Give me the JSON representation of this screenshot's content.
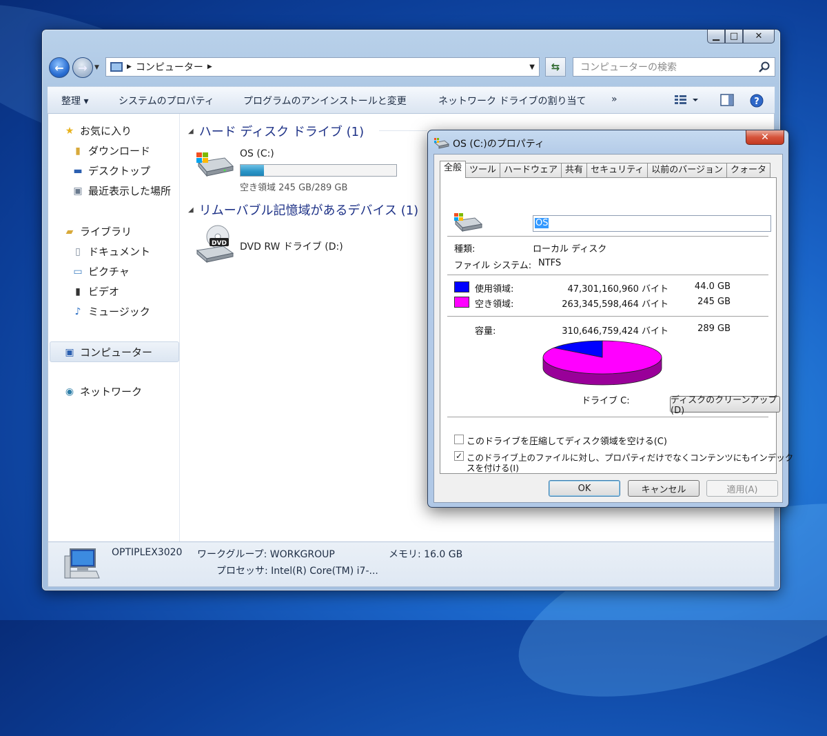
{
  "explorer": {
    "caption": {
      "minimize": "▁",
      "maximize": "□",
      "close": "✕"
    },
    "address": {
      "location": "コンピューター"
    },
    "search": {
      "placeholder": "コンピューターの検索"
    },
    "toolbar": {
      "organize": "整理 ▾",
      "system_properties": "システムのプロパティ",
      "uninstall": "プログラムのアンインストールと変更",
      "map_drive": "ネットワーク ドライブの割り当て",
      "more": "»"
    },
    "nav_pane": {
      "favorites": "お気に入り",
      "downloads": "ダウンロード",
      "desktop": "デスクトップ",
      "recent": "最近表示した場所",
      "libraries": "ライブラリ",
      "documents": "ドキュメント",
      "pictures": "ピクチャ",
      "videos": "ビデオ",
      "music": "ミュージック",
      "computer": "コンピューター",
      "network": "ネットワーク"
    },
    "groups": {
      "hdd_header": "ハード ディスク ドライブ (1)",
      "removable_header": "リムーバブル記憶域があるデバイス (1)"
    },
    "drives": {
      "c": {
        "name": "OS (C:)",
        "free_text": "空き領域 245 GB/289 GB",
        "used_fraction": 0.152
      },
      "d": {
        "name": "DVD RW ドライブ (D:)",
        "badge": "DVD"
      }
    },
    "status": {
      "computer_name": "OPTIPLEX3020",
      "workgroup": "ワークグループ: WORKGROUP",
      "memory": "メモリ: 16.0 GB",
      "processor": "プロセッサ: Intel(R) Core(TM) i7-..."
    }
  },
  "dialog": {
    "title": "OS (C:)のプロパティ",
    "close": "✕",
    "tabs": [
      "全般",
      "ツール",
      "ハードウェア",
      "共有",
      "セキュリティ",
      "以前のバージョン",
      "クォータ"
    ],
    "name_value": "OS",
    "type_label": "種類:",
    "type_value": "ローカル ディスク",
    "fs_label": "ファイル システム:",
    "fs_value": "NTFS",
    "used": {
      "label": "使用領域:",
      "bytes": "47,301,160,960 バイト",
      "size": "44.0 GB",
      "color": "#0000ff"
    },
    "free": {
      "label": "空き領域:",
      "bytes": "263,345,598,464 バイト",
      "size": "245 GB",
      "color": "#ff00ff"
    },
    "capacity": {
      "label": "容量:",
      "bytes": "310,646,759,424 バイト",
      "size": "289 GB"
    },
    "drive_label": "ドライブ C:",
    "cleanup_button": "ディスクのクリーンアップ(D)",
    "compress_checkbox": {
      "label": "このドライブを圧縮してディスク領域を空ける(C)",
      "checked": false
    },
    "index_checkbox": {
      "label_line1": "このドライブ上のファイルに対し、プロパティだけでなくコンテンツにもインデック",
      "label_line2": "スを付ける(I)",
      "checked": true
    },
    "ok_button": "OK",
    "cancel_button": "キャンセル",
    "apply_button": "適用(A)",
    "used_fraction": 0.152
  }
}
